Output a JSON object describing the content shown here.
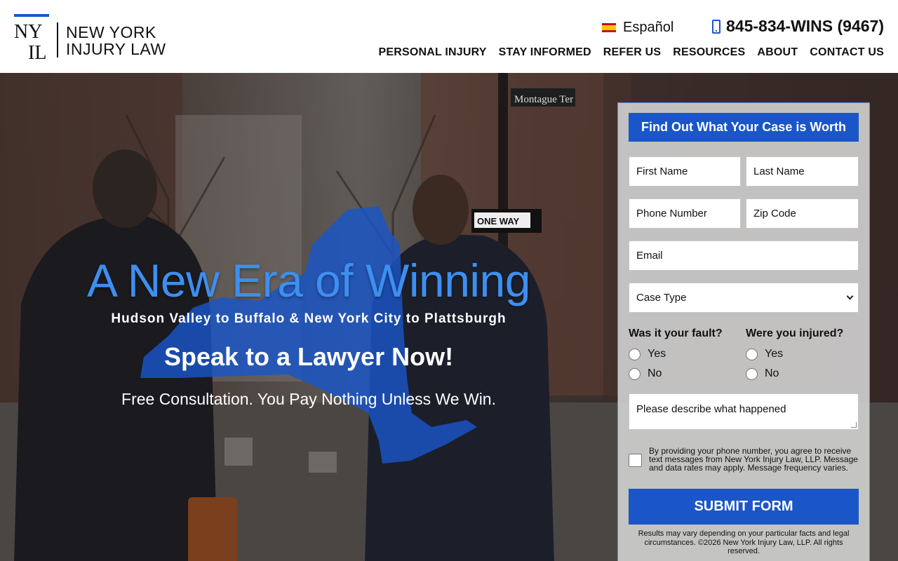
{
  "header": {
    "logo": {
      "monogram": "NY IL",
      "line1": "NEW YORK",
      "line2": "INJURY LAW"
    },
    "language": {
      "label": "Español",
      "icon": "spain-flag-icon"
    },
    "phone": {
      "label": "845-834-WINS (9467)",
      "icon": "mobile-phone-icon"
    },
    "nav": [
      "PERSONAL INJURY",
      "STAY INFORMED",
      "REFER US",
      "RESOURCES",
      "ABOUT",
      "CONTACT US"
    ]
  },
  "hero": {
    "headline": "A New Era of Winning",
    "region": "Hudson Valley to Buffalo & New York City to Plattsburgh",
    "cta": "Speak to a Lawyer Now!",
    "tagline": "Free Consultation. You Pay Nothing Unless We Win."
  },
  "form": {
    "title": "Find Out What Your Case is Worth",
    "first_name": "First Name",
    "last_name": "Last Name",
    "phone": "Phone Number",
    "zip": "Zip Code",
    "email": "Email",
    "case_type": "Case Type",
    "q_fault": "Was it your fault?",
    "q_injured": "Were you injured?",
    "yes": "Yes",
    "no": "No",
    "description": "Please describe what happened",
    "consent": "By providing your phone number, you agree to receive text messages from New York Injury Law, LLP. Message and data rates may apply. Message frequency varies.",
    "submit": "SUBMIT FORM",
    "disclaimer": "Results may vary depending on your particular facts and legal circumstances. ©2026 New York Injury Law, LLP. All rights reserved."
  },
  "colors": {
    "brand_blue": "#1a56c8",
    "headline_blue": "#3d8ff0"
  }
}
